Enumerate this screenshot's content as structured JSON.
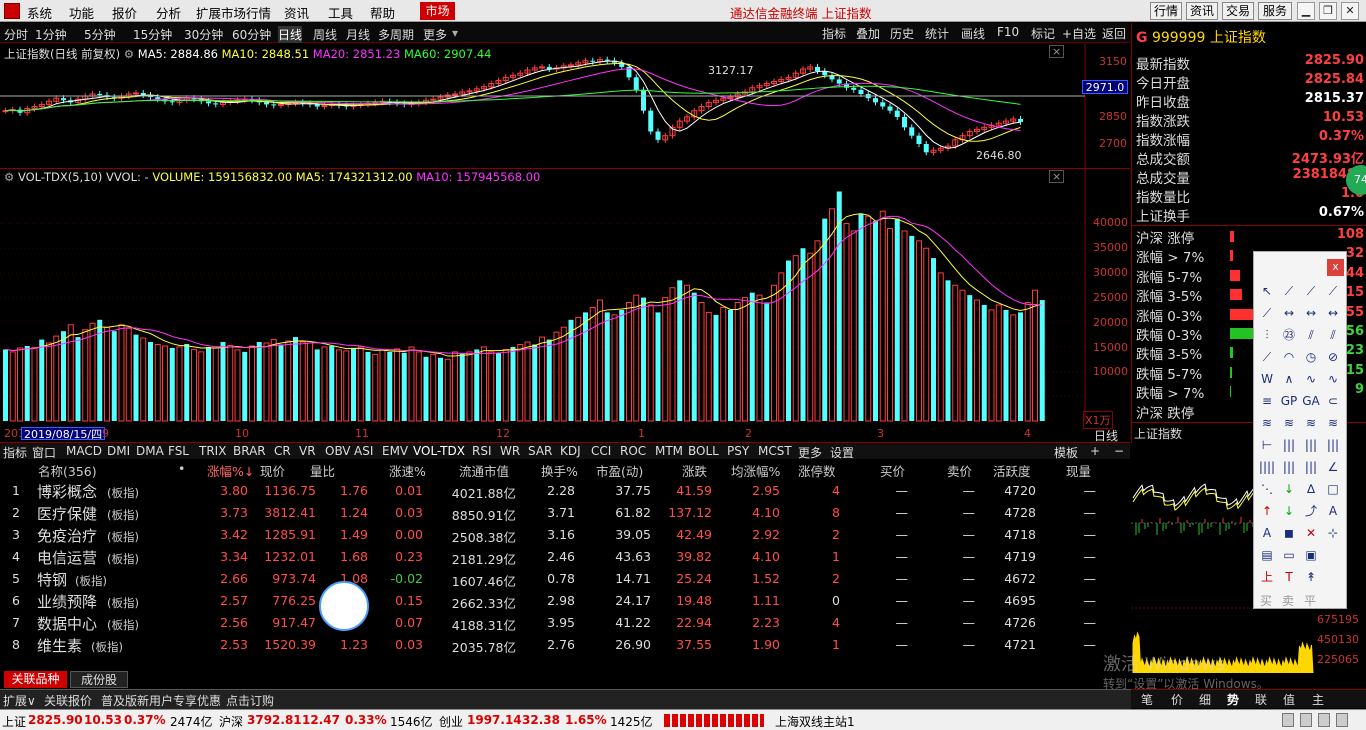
{
  "menu": {
    "items": [
      "系统",
      "功能",
      "报价",
      "分析",
      "扩展市场行情",
      "资讯",
      "工具",
      "帮助"
    ],
    "market": "市场",
    "title": "通达信金融终端 上证指数",
    "buttons": [
      "行情",
      "资讯",
      "交易",
      "服务"
    ]
  },
  "period": {
    "items": [
      "分时",
      "1分钟",
      "5分钟",
      "15分钟",
      "30分钟",
      "60分钟",
      "日线",
      "周线",
      "月线",
      "多周期",
      "更多"
    ],
    "tools": [
      "指标",
      "叠加",
      "历史",
      "统计",
      "画线",
      "F10",
      "标记",
      "+自选",
      "返回"
    ]
  },
  "kline": {
    "title": "上证指数(日线 前复权)",
    "ma5": "MA5: 2884.86",
    "ma10": "MA10: 2848.51",
    "ma20": "MA20: 2851.23",
    "ma60": "MA60: 2907.44",
    "high_label": "3127.17",
    "low_label": "2646.80",
    "price_box": "2971.0",
    "y_ticks": [
      "3150",
      "3000",
      "2850",
      "2700"
    ]
  },
  "volume": {
    "title": "VOL-TDX(5,10)",
    "vvol": "VVOL: -",
    "volume": "VOLUME: 159156832.00",
    "ma5": "MA5: 174321312.00",
    "ma10": "MA10: 157945568.00",
    "y_ticks": [
      "40000",
      "35000",
      "30000",
      "25000",
      "20000",
      "15000",
      "10000"
    ],
    "unit": "X1万"
  },
  "xaxis": {
    "date_box": "2019/08/15/四",
    "labels": [
      "201",
      "9",
      "10",
      "11",
      "12",
      "1",
      "2",
      "3",
      "4"
    ],
    "mode": "日线"
  },
  "chart_data": {
    "type": "bar",
    "title": "VOL-TDX(5,10)",
    "ylim": [
      0,
      47000
    ],
    "series": [
      {
        "values": [
          14500,
          14000,
          14800,
          15200,
          14900,
          16500,
          15800,
          17200,
          18200,
          19500,
          17000,
          18500,
          19800,
          20500,
          19000,
          18200,
          19500,
          18800,
          17500,
          16800,
          16000,
          15500,
          15200,
          14800,
          15000,
          15600,
          14500,
          14000,
          15000,
          14800,
          16000,
          15300,
          14400,
          14000,
          15200,
          16000,
          15800,
          16500,
          15500,
          16200,
          17000,
          16000,
          15800,
          14500,
          15000,
          15200,
          14400,
          14200,
          14800,
          15000,
          14000,
          13500,
          14500,
          14000,
          14600,
          13800,
          15000,
          14000,
          13000,
          13500,
          12800,
          12500,
          14000,
          13800,
          14000,
          14500,
          15000,
          14000,
          13800,
          14500,
          15000,
          15500,
          16000,
          15500,
          17000,
          16500,
          18000,
          19000,
          20500,
          21000,
          22000,
          23000,
          24500,
          22000,
          21500,
          22500,
          24000,
          25500,
          25000,
          23500,
          22000,
          25000,
          27000,
          28500,
          27500,
          26000,
          24000,
          22000,
          21500,
          23000,
          22500,
          24000,
          25000,
          26000,
          25500,
          24000,
          27500,
          30000,
          32500,
          33500,
          35000,
          34000,
          36500,
          41000,
          43000,
          46500,
          40000,
          38500,
          42000,
          41500,
          40500,
          42500,
          39000,
          41000,
          38500,
          37500,
          36500,
          35000,
          33000,
          30000,
          28500,
          27500,
          26500,
          25500,
          24500,
          23500,
          22500,
          23500,
          22500,
          21500,
          22000,
          24000,
          26500,
          24500
        ]
      }
    ]
  },
  "right": {
    "code": "999999",
    "name": "上证指数",
    "rows": [
      [
        "最新指数",
        "2825.90"
      ],
      [
        "今日开盘",
        "2825.84"
      ],
      [
        "昨日收盘",
        "2815.37"
      ],
      [
        "指数涨跌",
        "10.53"
      ],
      [
        "指数涨幅",
        "0.37%"
      ],
      [
        "总成交额",
        "2473.93亿"
      ],
      [
        "总成交量",
        "2381848"
      ],
      [
        "指数量比",
        "1.0"
      ],
      [
        "上证换手",
        "0.67%"
      ]
    ],
    "stats": [
      [
        "沪深 涨停",
        "108"
      ],
      [
        "涨幅 > 7%",
        "32"
      ],
      [
        "涨幅 5-7%",
        "44"
      ],
      [
        "涨幅 3-5%",
        "15"
      ],
      [
        "涨幅 0-3%",
        "55"
      ],
      [
        "跌幅 0-3%",
        "56"
      ],
      [
        "跌幅 3-5%",
        "23"
      ],
      [
        "跌幅 5-7%",
        "15"
      ],
      [
        "跌幅 > 7%",
        "9"
      ],
      [
        "沪深 跌停",
        ""
      ]
    ],
    "mini_title": "上证指数",
    "mini_vol": [
      "675195",
      "450130",
      "225065"
    ],
    "bottom_tabs": [
      "笔",
      "价",
      "细",
      "势",
      "联",
      "值",
      "主"
    ],
    "badge": "74"
  },
  "tabs": {
    "items": [
      "指标",
      "窗口",
      "MACD",
      "DMI",
      "DMA",
      "FSL",
      "TRIX",
      "BRAR",
      "CR",
      "VR",
      "OBV",
      "ASI",
      "EMV",
      "VOL-TDX",
      "RSI",
      "WR",
      "SAR",
      "KDJ",
      "CCI",
      "ROC",
      "MTM",
      "BOLL",
      "PSY",
      "MCST",
      "更多",
      "设置"
    ],
    "template": "模板"
  },
  "table": {
    "headers": [
      "名称(356)",
      "•",
      "涨幅%↓",
      "现价",
      "量比",
      "涨速%",
      "流通市值",
      "换手%",
      "市盈(动)",
      "涨跌",
      "均涨幅%",
      "涨停数",
      "买价",
      "卖价",
      "活跃度",
      "现量"
    ],
    "rows": [
      [
        "1",
        "博彩概念",
        "(板指)",
        "3.80",
        "1136.75",
        "1.76",
        "0.01",
        "4021.88亿",
        "2.28",
        "37.75",
        "41.59",
        "2.95",
        "4",
        "—",
        "—",
        "4720",
        "—"
      ],
      [
        "2",
        "医疗保健",
        "(板指)",
        "3.73",
        "3812.41",
        "1.24",
        "0.03",
        "8850.91亿",
        "3.71",
        "61.82",
        "137.12",
        "4.10",
        "8",
        "—",
        "—",
        "4728",
        "—"
      ],
      [
        "3",
        "免疫治疗",
        "(板指)",
        "3.42",
        "1285.91",
        "1.49",
        "0.00",
        "2508.38亿",
        "3.16",
        "39.05",
        "42.49",
        "2.92",
        "2",
        "—",
        "—",
        "4718",
        "—"
      ],
      [
        "4",
        "电信运营",
        "(板指)",
        "3.34",
        "1232.01",
        "1.68",
        "0.23",
        "2181.29亿",
        "2.46",
        "43.63",
        "39.82",
        "4.10",
        "1",
        "—",
        "—",
        "4719",
        "—"
      ],
      [
        "5",
        "特钢",
        "(板指)",
        "2.66",
        "973.74",
        "1.08",
        "-0.02",
        "1607.46亿",
        "0.78",
        "14.71",
        "25.24",
        "1.52",
        "2",
        "—",
        "—",
        "4672",
        "—"
      ],
      [
        "6",
        "业绩预降",
        "(板指)",
        "2.57",
        "776.25",
        "",
        "0.15",
        "2662.33亿",
        "2.98",
        "24.17",
        "19.48",
        "1.11",
        "0",
        "—",
        "—",
        "4695",
        "—"
      ],
      [
        "7",
        "数据中心",
        "(板指)",
        "2.56",
        "917.47",
        "",
        "0.07",
        "4188.31亿",
        "3.95",
        "41.22",
        "22.94",
        "2.23",
        "4",
        "—",
        "—",
        "4726",
        "—"
      ],
      [
        "8",
        "维生素",
        "(板指)",
        "2.53",
        "1520.39",
        "1.23",
        "0.03",
        "2035.78亿",
        "2.76",
        "26.90",
        "37.55",
        "1.90",
        "1",
        "—",
        "—",
        "4721",
        "—"
      ]
    ]
  },
  "sidebar_tabs": [
    "关联品种",
    "成份股"
  ],
  "bottom": {
    "items": [
      "扩展∨",
      "关联报价",
      "普及版新用户专享优惠",
      "点击订购"
    ]
  },
  "status": {
    "sh_name": "上证",
    "sh_val": "2825.90",
    "sh_chg": "10.53",
    "sh_pct": "0.37%",
    "sh_amt": "2474亿",
    "hs_name": "沪深",
    "hs_val": "3792.81",
    "hs_chg": "12.47",
    "hs_pct": "0.33%",
    "hs_amt": "1546亿",
    "cy_name": "创业",
    "cy_val": "1997.14",
    "cy_chg": "32.38",
    "cy_pct": "1.65%",
    "cy_amt": "1425亿",
    "server": "上海双线主站1"
  },
  "watermark": {
    "line1": "激活 Windows",
    "line2": "转到“设置”以激活 Windows。"
  },
  "tool_footer": [
    "买",
    "卖",
    "平"
  ],
  "colors": {
    "up": "#ff4d4d",
    "down": "#54ffff",
    "bg": "#000000",
    "ma5": "#ffffff",
    "ma10": "#ffff00",
    "ma20": "#ff00ff",
    "ma60": "#00ff00"
  }
}
